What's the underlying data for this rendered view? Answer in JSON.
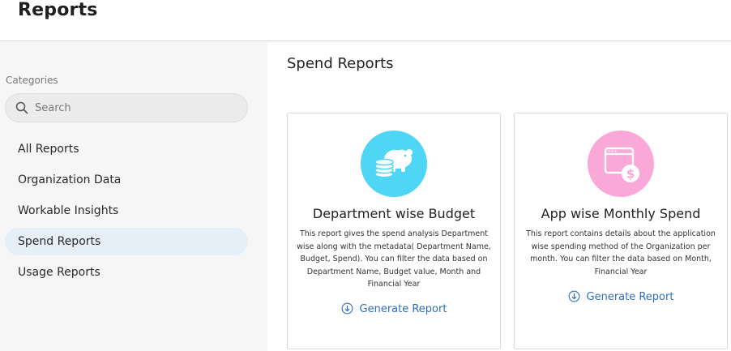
{
  "header": {
    "title": "Reports"
  },
  "sidebar": {
    "categories_label": "Categories",
    "search": {
      "placeholder": "Search",
      "value": ""
    },
    "items": [
      {
        "label": "All Reports"
      },
      {
        "label": "Organization Data"
      },
      {
        "label": "Workable Insights"
      },
      {
        "label": "Spend Reports"
      },
      {
        "label": "Usage Reports"
      }
    ]
  },
  "main": {
    "title": "Spend Reports",
    "cards": [
      {
        "icon": "piggy-bank-icon",
        "icon_bg": "#4fd6f4",
        "title": "Department wise Budget",
        "description": "This report gives the spend analysis Department wise along with the metadata( Department Name, Budget, Spend). You can filter the data based on Department Name, Budget value, Month and Financial Year",
        "action_label": "Generate Report"
      },
      {
        "icon": "app-dollar-icon",
        "icon_bg": "#f9a8d8",
        "title": "App wise Monthly Spend",
        "description": "This report contains details about the application wise spending method of the Organization per month. You can filter the data based on Month, Financial Year",
        "action_label": "Generate Report"
      }
    ]
  },
  "colors": {
    "accent": "#2f6fb8",
    "active_nav_bg": "#e6eef8"
  }
}
